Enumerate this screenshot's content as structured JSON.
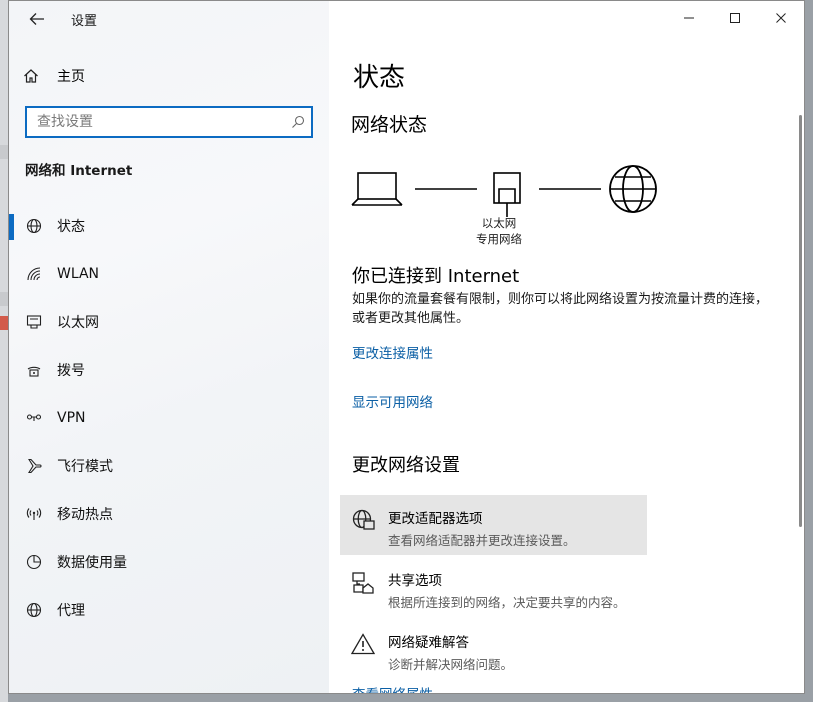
{
  "window": {
    "title": "设置",
    "controls": {
      "minimize_icon": "minimize-icon",
      "maximize_icon": "maximize-icon",
      "close_icon": "close-icon"
    }
  },
  "sidebar": {
    "home_label": "主页",
    "search_placeholder": "查找设置",
    "section_title": "网络和 Internet",
    "items": [
      {
        "label": "状态",
        "icon": "globe-icon",
        "active": true
      },
      {
        "label": "WLAN",
        "icon": "wifi-icon"
      },
      {
        "label": "以太网",
        "icon": "ethernet-icon"
      },
      {
        "label": "拨号",
        "icon": "dialup-icon"
      },
      {
        "label": "VPN",
        "icon": "vpn-icon"
      },
      {
        "label": "飞行模式",
        "icon": "airplane-icon"
      },
      {
        "label": "移动热点",
        "icon": "hotspot-icon"
      },
      {
        "label": "数据使用量",
        "icon": "data-usage-icon"
      },
      {
        "label": "代理",
        "icon": "globe-icon"
      }
    ]
  },
  "main": {
    "page_title": "状态",
    "network_status_heading": "网络状态",
    "diagram": {
      "adapter_name": "以太网",
      "network_type": "专用网络"
    },
    "connected_title": "你已连接到 Internet",
    "connected_desc": "如果你的流量套餐有限制，则你可以将此网络设置为按流量计费的连接，或者更改其他属性。",
    "link_change_connection": "更改连接属性",
    "link_show_networks": "显示可用网络",
    "change_settings_heading": "更改网络设置",
    "options": [
      {
        "title": "更改适配器选项",
        "desc": "查看网络适配器并更改连接设置。",
        "icon": "adapter-icon"
      },
      {
        "title": "共享选项",
        "desc": "根据所连接到的网络，决定要共享的内容。",
        "icon": "sharing-icon"
      },
      {
        "title": "网络疑难解答",
        "desc": "诊断并解决网络问题。",
        "icon": "warning-icon"
      }
    ],
    "link_view_properties": "查看网络属性"
  },
  "colors": {
    "accent": "#0c6bc2",
    "link": "#0b5fa5",
    "hover": "#e5e5e5"
  }
}
